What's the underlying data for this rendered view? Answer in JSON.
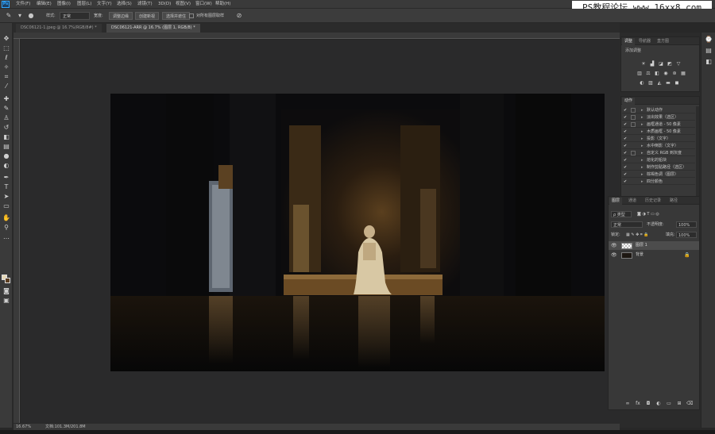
{
  "app": {
    "logo": "Ps"
  },
  "watermark": "PS教程论坛 www.16xx8.com",
  "menu": [
    "文件(F)",
    "编辑(E)",
    "图像(I)",
    "图层(L)",
    "文字(Y)",
    "选择(S)",
    "滤镜(T)",
    "3D(D)",
    "视图(V)",
    "窗口(W)",
    "帮助(H)"
  ],
  "options_bar": {
    "style_label": "样式:",
    "style_value": "正常",
    "width_label": "宽度:",
    "btn_refine": "调整边缘",
    "btn_load": "创建新视",
    "btn_select": "选择并遮住",
    "checkbox_label": "对所有图层取样"
  },
  "tabs": [
    {
      "label": "DSC06121-1.jpeg @ 16.7%(RGB/8#) *"
    },
    {
      "label": "DSC06121-ARR @ 16.7% (图层 1, RGB/8) *"
    }
  ],
  "status": {
    "zoom": "16.67%",
    "doc": "文档:101.3M/201.8M"
  },
  "adjustments_panel": {
    "tabs": [
      "调整",
      "导航器",
      "直方图"
    ],
    "hint": "添加调整",
    "icons": [
      "brightness-icon",
      "levels-icon",
      "curves-icon",
      "exposure-icon",
      "vibrance-icon",
      "hue-icon",
      "color-balance-icon",
      "bw-icon",
      "photo-filter-icon",
      "channel-mixer-icon",
      "lookup-icon",
      "invert-icon",
      "posterize-icon",
      "threshold-icon",
      "gradient-map-icon",
      "selective-color-icon"
    ]
  },
  "actions_panel": {
    "tab": "动作",
    "rows": [
      {
        "check": "✔",
        "dialog": true,
        "label": "默认动作",
        "folder": true
      },
      {
        "check": "✔",
        "dialog": true,
        "label": "淡出效果（选区）"
      },
      {
        "check": "✔",
        "dialog": true,
        "label": "画框通道 - 50 像素"
      },
      {
        "check": "✔",
        "dialog": false,
        "label": "木质画框 - 50 像素"
      },
      {
        "check": "✔",
        "dialog": false,
        "label": "投影（文字）"
      },
      {
        "check": "✔",
        "dialog": false,
        "label": "水中倒影（文字）"
      },
      {
        "check": "✔",
        "dialog": true,
        "label": "自定义 RGB 到灰度"
      },
      {
        "check": "✔",
        "dialog": false,
        "label": "熔化的铅块"
      },
      {
        "check": "✔",
        "dialog": false,
        "label": "制作剪贴路径（选区）"
      },
      {
        "check": "✔",
        "dialog": false,
        "label": "棕褐色调（图层）"
      },
      {
        "check": "✔",
        "dialog": false,
        "label": "四分颜色"
      }
    ]
  },
  "layers_panel": {
    "tabs": [
      "图层",
      "通道",
      "历史记录",
      "路径"
    ],
    "kind_label": "ρ 类型",
    "blend_mode": "正常",
    "opacity_label": "不透明度:",
    "opacity_value": "100%",
    "lock_label": "锁定:",
    "fill_label": "填充:",
    "fill_value": "100%",
    "layers": [
      {
        "name": "图层 1",
        "selected": true,
        "visible": true,
        "locked": false
      },
      {
        "name": "背景",
        "selected": false,
        "visible": true,
        "locked": true
      }
    ]
  },
  "toolbar": {
    "tools": [
      "move-tool",
      "marquee-tool",
      "lasso-tool",
      "quick-select-tool",
      "crop-tool",
      "eyedropper-tool",
      "healing-tool",
      "brush-tool",
      "stamp-tool",
      "history-brush-tool",
      "eraser-tool",
      "gradient-tool",
      "blur-tool",
      "dodge-tool",
      "pen-tool",
      "type-tool",
      "path-select-tool",
      "shape-tool",
      "hand-tool",
      "zoom-tool",
      "more-tools",
      "fg-bg-color",
      "quick-mask-tool",
      "screen-mode-tool"
    ]
  },
  "colors": {
    "foreground": "#e6d7b4",
    "background": "#5c3e21",
    "accent": "#31a8ff"
  }
}
